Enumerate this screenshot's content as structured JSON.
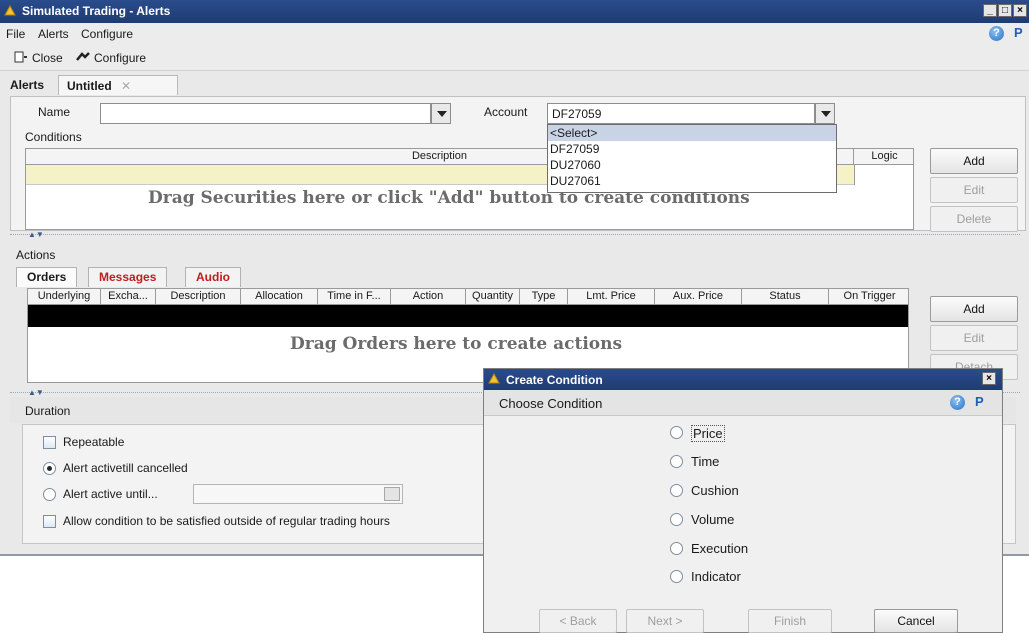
{
  "window": {
    "title": "Simulated Trading - Alerts"
  },
  "menu": {
    "file": "File",
    "alerts": "Alerts",
    "configure": "Configure"
  },
  "toolbar": {
    "close_label": "Close",
    "configure_label": "Configure"
  },
  "tabs": {
    "alerts": "Alerts",
    "untitled": "Untitled"
  },
  "alert_form": {
    "name_label": "Name",
    "name_value": "",
    "account_label": "Account",
    "account_value": "DF27059",
    "account_options": [
      "<Select>",
      "DF27059",
      "DU27060",
      "DU27061"
    ],
    "conditions_label": "Conditions",
    "conditions_columns": {
      "description": "Description",
      "logic": "Logic"
    },
    "conditions_hint": "Drag Securities here or click \"Add\" button to create conditions",
    "buttons": {
      "add": "Add",
      "edit": "Edit",
      "delete": "Delete"
    }
  },
  "actions": {
    "label": "Actions",
    "tabs": [
      "Orders",
      "Messages",
      "Audio"
    ],
    "columns": [
      "Underlying",
      "Excha...",
      "Description",
      "Allocation",
      "Time in F...",
      "Action",
      "Quantity",
      "Type",
      "Lmt. Price",
      "Aux. Price",
      "Status",
      "On Trigger"
    ],
    "hint": "Drag Orders here to create actions",
    "buttons": {
      "add": "Add",
      "edit": "Edit",
      "detach": "Detach"
    }
  },
  "duration": {
    "label": "Duration",
    "repeatable": "Repeatable",
    "active_till_cancelled": "Alert activetill cancelled",
    "active_until": "Alert active until...",
    "outside_hours": "Allow condition to be satisfied outside of regular trading hours"
  },
  "dialog": {
    "title": "Create Condition",
    "subtitle": "Choose Condition",
    "options": [
      "Price",
      "Time",
      "Cushion",
      "Volume",
      "Execution",
      "Indicator"
    ],
    "buttons": {
      "back": "< Back",
      "next": "Next >",
      "finish": "Finish",
      "cancel": "Cancel"
    }
  },
  "colors": {
    "title_bar": "#1f3b73",
    "red_tab": "#c01d1d",
    "selection": "#c9d3e6"
  }
}
